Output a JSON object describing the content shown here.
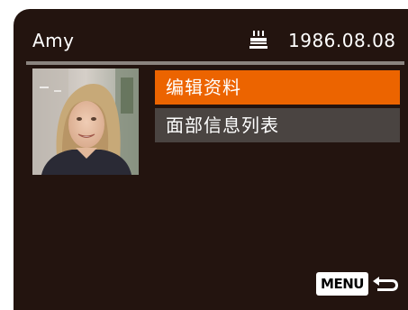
{
  "header": {
    "name": "Amy",
    "birthday_icon": "birthday-cake-icon",
    "date": "1986.08.08"
  },
  "thumbnail": {
    "icon": "face-photo-thumbnail"
  },
  "menu": {
    "items": [
      {
        "label": "编辑资料",
        "selected": true
      },
      {
        "label": "面部信息列表",
        "selected": false
      }
    ]
  },
  "footer": {
    "menu_label": "MENU",
    "back_icon": "return-arrow-icon"
  },
  "colors": {
    "screen_background": "#23140f",
    "selected_item": "#ec6400",
    "normal_item": "#4a4441",
    "divider": "#8b847f"
  }
}
